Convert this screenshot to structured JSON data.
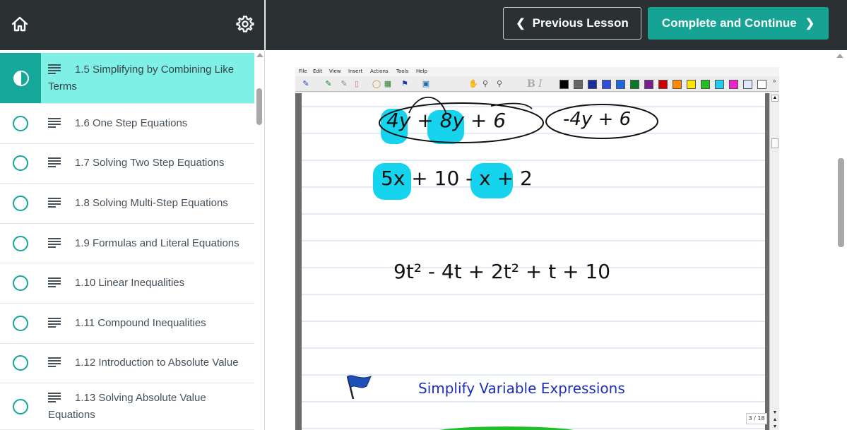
{
  "sidebar": {
    "lessons": [
      {
        "label": "1.5 Simplifying by Combining Like Terms",
        "status": "in-progress",
        "active": true
      },
      {
        "label": "1.6 One Step Equations",
        "status": "not-started"
      },
      {
        "label": "1.7 Solving Two Step Equations",
        "status": "not-started"
      },
      {
        "label": "1.8 Solving Multi-Step Equations",
        "status": "not-started"
      },
      {
        "label": "1.9 Formulas and Literal Equations",
        "status": "not-started"
      },
      {
        "label": "1.10 Linear Inequalities",
        "status": "not-started"
      },
      {
        "label": "1.11 Compound Inequalities",
        "status": "not-started"
      },
      {
        "label": "1.12 Introduction to Absolute Value",
        "status": "not-started"
      },
      {
        "label": "1.13 Solving Absolute Value Equations",
        "status": "not-started"
      }
    ]
  },
  "topbar": {
    "prev_label": "Previous Lesson",
    "next_label": "Complete and Continue"
  },
  "video": {
    "menu": [
      "File",
      "Edit",
      "View",
      "Insert",
      "Actions",
      "Tools",
      "Help"
    ],
    "swatch_colors": [
      "#000000",
      "#666666",
      "#1c2e9e",
      "#2e4fd6",
      "#1a6ad8",
      "#0a7a2a",
      "#7b1d8c",
      "#cc0000",
      "#ff8800",
      "#ffe600",
      "#22bb22",
      "#22ccee",
      "#ee22cc",
      "#e0e8ff",
      "#ffffff"
    ],
    "expr1a": "4y + 8y + 6",
    "expr1b": "-4y + 6",
    "expr2": "5x + 10 - x + 2",
    "expr3": "9t² - 4t + 2t² + t + 10",
    "title": "Simplify Variable Expressions",
    "page_counter": "3 / 18",
    "highlight_color": "#16d4ee"
  }
}
